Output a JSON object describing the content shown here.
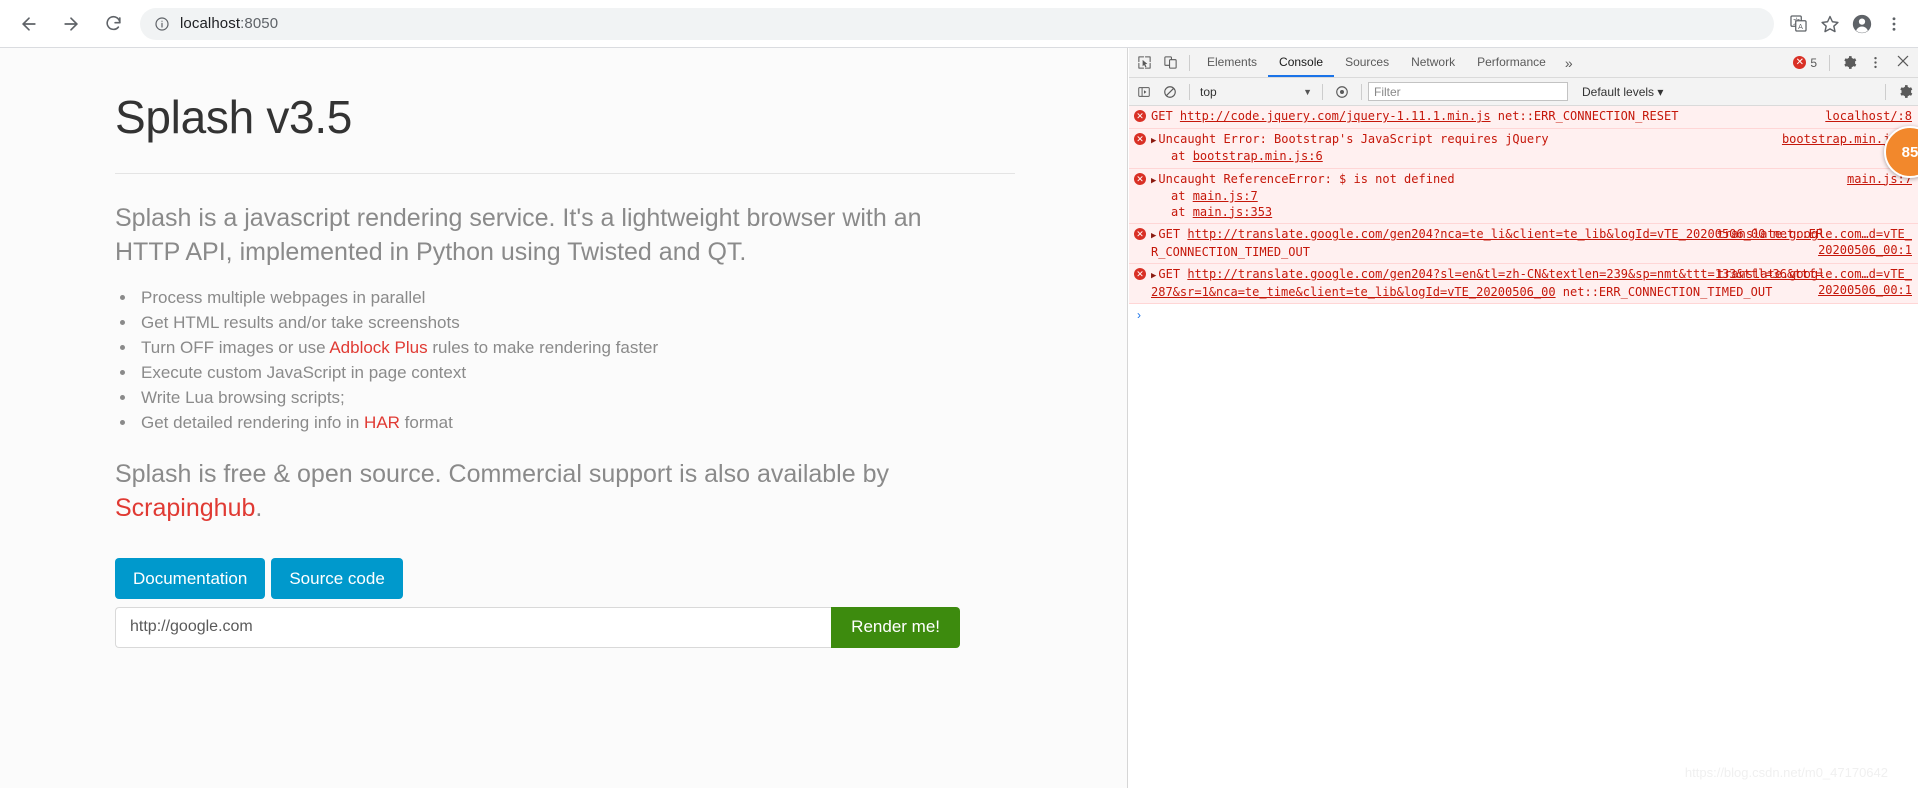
{
  "browser": {
    "back_label": "Back",
    "forward_label": "Forward",
    "reload_label": "Reload",
    "site_info_label": "View site information",
    "url_host": "localhost",
    "url_port": ":8050",
    "translate_label": "Translate this page",
    "bookmark_label": "Bookmark this tab",
    "profile_label": "Profile",
    "menu_label": "Customize and control Google Chrome"
  },
  "page": {
    "title": "Splash v3.5",
    "lead": "Splash is a javascript rendering service. It's a lightweight browser with an HTTP API, implemented in Python using Twisted and QT.",
    "features": [
      {
        "pre": "Process multiple webpages in parallel",
        "link": "",
        "post": ""
      },
      {
        "pre": "Get HTML results and/or take screenshots",
        "link": "",
        "post": ""
      },
      {
        "pre": "Turn OFF images or use ",
        "link": "Adblock Plus",
        "post": " rules to make rendering faster"
      },
      {
        "pre": "Execute custom JavaScript in page context",
        "link": "",
        "post": ""
      },
      {
        "pre": "Write Lua browsing scripts;",
        "link": "",
        "post": ""
      },
      {
        "pre": "Get detailed rendering info in ",
        "link": "HAR",
        "post": " format"
      }
    ],
    "closing_pre": "Splash is free & open source. Commercial support is also available by ",
    "closing_link": "Scrapinghub",
    "closing_post": ".",
    "buttons": {
      "documentation": "Documentation",
      "source_code": "Source code"
    },
    "render_form": {
      "url_value": "http://google.com",
      "url_placeholder": "http://google.com",
      "submit_label": "Render me!"
    },
    "accent_blue": "#0099cc",
    "accent_green": "#3d8b0e",
    "accent_red": "#e03a33"
  },
  "devtools": {
    "inspect_label": "Inspect element",
    "device_toggle_label": "Toggle device toolbar",
    "tabs": [
      {
        "label": "Elements",
        "active": false
      },
      {
        "label": "Console",
        "active": true
      },
      {
        "label": "Sources",
        "active": false
      },
      {
        "label": "Network",
        "active": false
      },
      {
        "label": "Performance",
        "active": false
      }
    ],
    "more_tabs": "»",
    "error_count": "5",
    "settings_label": "Settings",
    "menu_label": "Customize and control DevTools",
    "close_label": "Close DevTools",
    "toolbar": {
      "sidebar_label": "Show console sidebar",
      "clear_label": "Clear console",
      "context": "top",
      "live_expression_label": "Create live expression",
      "filter_placeholder": "Filter",
      "levels": "Default levels ▾",
      "settings_label": "Console settings"
    },
    "messages": [
      {
        "text": "GET http://code.jquery.com/jquery-1.11.1.min.js net::ERR_CONNECTION_RESET",
        "link_text": "http://code.jquery.com/jquery-1.11.1.min.js",
        "source": "localhost/:8",
        "expandable": false,
        "stack": []
      },
      {
        "text": "Uncaught Error: Bootstrap's JavaScript requires jQuery",
        "link_text": "",
        "source": "bootstrap.min.js:6",
        "expandable": true,
        "stack": [
          "at bootstrap.min.js:6"
        ]
      },
      {
        "text": "Uncaught ReferenceError: $ is not defined",
        "link_text": "",
        "source": "main.js:7",
        "expandable": true,
        "stack": [
          "at main.js:7",
          "at main.js:353"
        ]
      },
      {
        "text": "GET http://translate.google.com/gen204?nca=te_li&client=te_lib&logId=vTE_20200506_00 net::ERR_CONNECTION_TIMED_OUT",
        "link_text": "http://translate.google.com/gen204?nca=te_li&client=te_lib&logId=vTE_20200506_00",
        "source": "translate.google.com…d=vTE_20200506_00:1",
        "expandable": true,
        "stack": []
      },
      {
        "text": "GET http://translate.google.com/gen204?sl=en&tl=zh-CN&textlen=239&sp=nmt&ttt=133&ttl=36&ttf=287&sr=1&nca=te_time&client=te_lib&logId=vTE_20200506_00 net::ERR_CONNECTION_TIMED_OUT",
        "link_text": "http://translate.google.com/gen204?sl=en&tl=zh-CN&textlen=239&sp=nmt&ttt=133&ttl=36&ttf=287&sr=1&nca=te_time&client=te_lib&logId=vTE_20200506_00",
        "source": "translate.google.com…d=vTE_20200506_00:1",
        "expandable": true,
        "stack": []
      }
    ],
    "prompt_symbol": "›"
  },
  "overlay": {
    "badge_value": "85",
    "badge_color": "#f2882c",
    "watermark": "https://blog.csdn.net/m0_47170642"
  }
}
